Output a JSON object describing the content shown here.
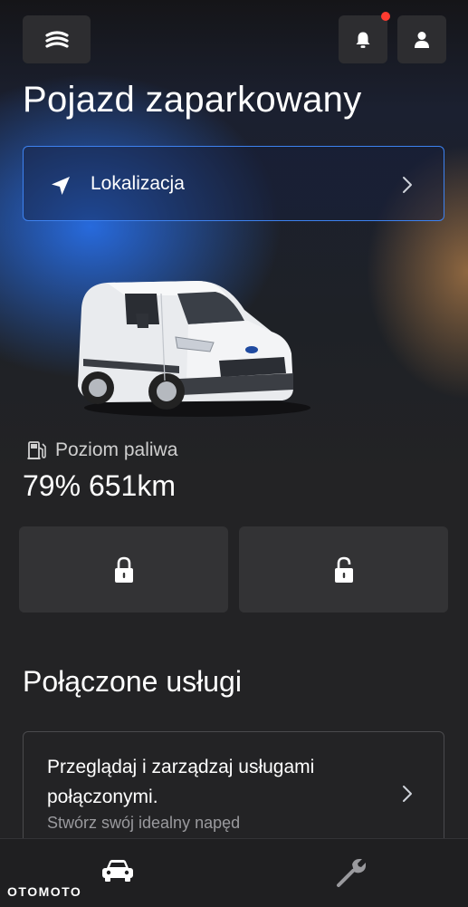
{
  "header": {
    "menu_icon": "menu-stack-icon",
    "bell_icon": "bell-icon",
    "user_icon": "user-icon",
    "notification_color": "#ff3b30"
  },
  "status": {
    "title": "Pojazd zaparkowany"
  },
  "location": {
    "label": "Lokalizacja",
    "icon": "navigation-arrow-icon",
    "accent": "#3d82f0"
  },
  "vehicle": {
    "image": "white-ford-transit-connect-van"
  },
  "fuel": {
    "icon": "fuel-pump-icon",
    "label": "Poziom paliwa",
    "values": "79% 651km"
  },
  "locks": {
    "lock_icon": "lock-closed-icon",
    "unlock_icon": "lock-open-icon"
  },
  "services": {
    "section_title": "Połączone usługi",
    "card_title": "Przeglądaj i zarządzaj usługami połączonymi.",
    "card_subtitle": "Stwórz swój idealny napęd"
  },
  "bottom_nav": {
    "items": [
      "car-icon",
      "wrench-icon"
    ]
  },
  "watermark": {
    "text": "OTOMOTO"
  }
}
